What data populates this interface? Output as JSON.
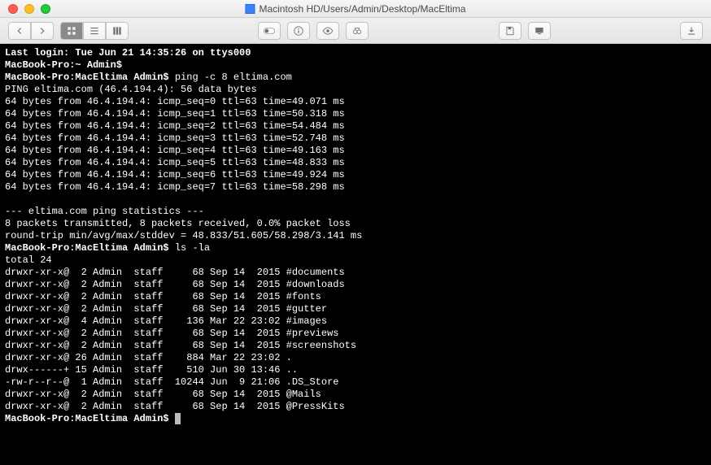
{
  "title": "Macintosh HD/Users/Admin/Desktop/MacEltima",
  "terminal": {
    "last_login": "Last login: Tue Jun 21 14:35:26 on ttys000",
    "prompt1_host": "MacBook-Pro:~ Admin$",
    "prompt2_host": "MacBook-Pro:MacEltima Admin$",
    "cmd_ping": "ping -c 8 eltima.com",
    "ping_header": "PING eltima.com (46.4.194.4): 56 data bytes",
    "ping_lines": [
      "64 bytes from 46.4.194.4: icmp_seq=0 ttl=63 time=49.071 ms",
      "64 bytes from 46.4.194.4: icmp_seq=1 ttl=63 time=50.318 ms",
      "64 bytes from 46.4.194.4: icmp_seq=2 ttl=63 time=54.484 ms",
      "64 bytes from 46.4.194.4: icmp_seq=3 ttl=63 time=52.748 ms",
      "64 bytes from 46.4.194.4: icmp_seq=4 ttl=63 time=49.163 ms",
      "64 bytes from 46.4.194.4: icmp_seq=5 ttl=63 time=48.833 ms",
      "64 bytes from 46.4.194.4: icmp_seq=6 ttl=63 time=49.924 ms",
      "64 bytes from 46.4.194.4: icmp_seq=7 ttl=63 time=58.298 ms"
    ],
    "stats_header": "--- eltima.com ping statistics ---",
    "stats_summary": "8 packets transmitted, 8 packets received, 0.0% packet loss",
    "stats_rtt": "round-trip min/avg/max/stddev = 48.833/51.605/58.298/3.141 ms",
    "cmd_ls": "ls -la",
    "ls_total": "total 24",
    "ls_lines": [
      "drwxr-xr-x@  2 Admin  staff     68 Sep 14  2015 #documents",
      "drwxr-xr-x@  2 Admin  staff     68 Sep 14  2015 #downloads",
      "drwxr-xr-x@  2 Admin  staff     68 Sep 14  2015 #fonts",
      "drwxr-xr-x@  2 Admin  staff     68 Sep 14  2015 #gutter",
      "drwxr-xr-x@  4 Admin  staff    136 Mar 22 23:02 #images",
      "drwxr-xr-x@  2 Admin  staff     68 Sep 14  2015 #previews",
      "drwxr-xr-x@  2 Admin  staff     68 Sep 14  2015 #screenshots",
      "drwxr-xr-x@ 26 Admin  staff    884 Mar 22 23:02 .",
      "drwx------+ 15 Admin  staff    510 Jun 30 13:46 ..",
      "-rw-r--r--@  1 Admin  staff  10244 Jun  9 21:06 .DS_Store",
      "drwxr-xr-x@  2 Admin  staff     68 Sep 14  2015 @Mails",
      "drwxr-xr-x@  2 Admin  staff     68 Sep 14  2015 @PressKits"
    ]
  }
}
